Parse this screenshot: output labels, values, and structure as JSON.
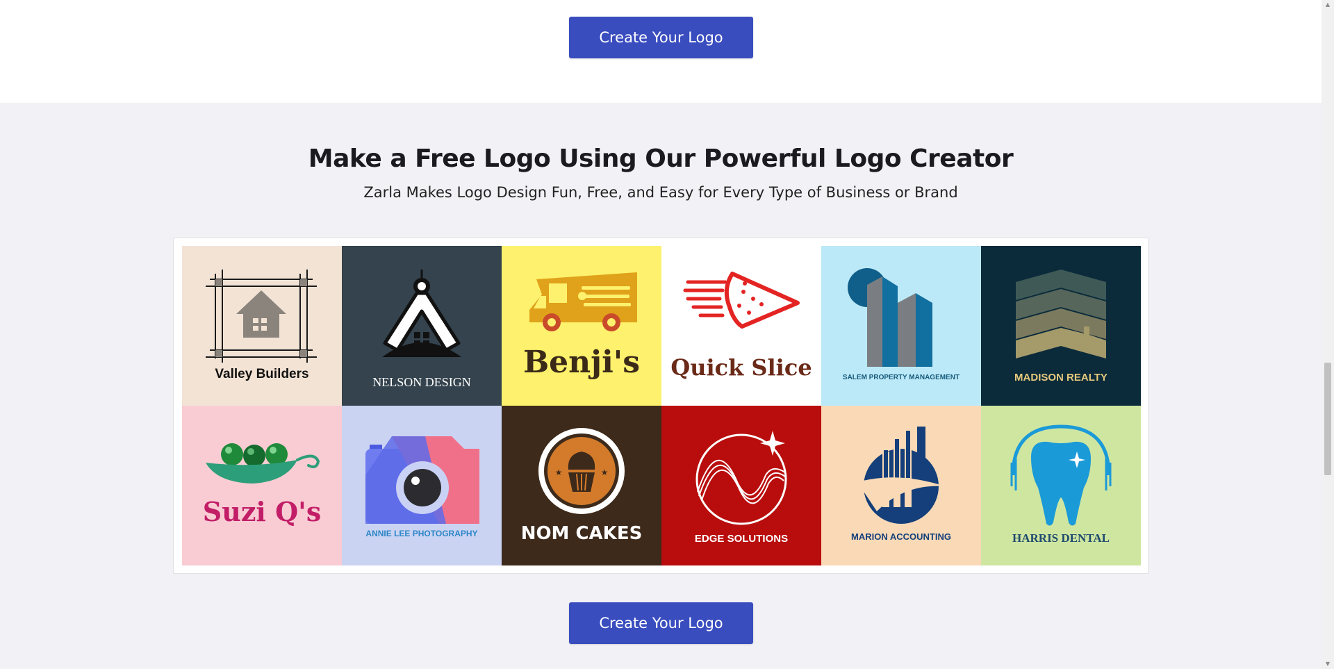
{
  "top_cta": {
    "label": "Create Your Logo"
  },
  "section": {
    "title": "Make a Free Logo Using Our Powerful Logo Creator",
    "subtitle": "Zarla Makes Logo Design Fun, Free, and Easy for Every Type of Business or Brand"
  },
  "logos": [
    {
      "name": "Valley Builders",
      "background": "#f3e3d4"
    },
    {
      "name": "NELSON DESIGN",
      "background": "#34434d"
    },
    {
      "name": "Benji's",
      "background": "#fdf16d"
    },
    {
      "name": "Quick Slice",
      "background": "#ffffff"
    },
    {
      "name": "SALEM PROPERTY MANAGEMENT",
      "background": "#bce9f8"
    },
    {
      "name": "MADISON REALTY",
      "background": "#0b2b3b"
    },
    {
      "name": "Suzi Q's",
      "background": "#f9ccd3"
    },
    {
      "name": "ANNIE LEE PHOTOGRAPHY",
      "background": "#cbd3f2"
    },
    {
      "name": "NOM CAKES",
      "background": "#3d2a1b"
    },
    {
      "name": "EDGE SOLUTIONS",
      "background": "#b90d0d"
    },
    {
      "name": "MARION ACCOUNTING",
      "background": "#f9d9b6"
    },
    {
      "name": "HARRIS DENTAL",
      "background": "#cfe6a1"
    }
  ],
  "bottom_cta": {
    "label": "Create Your Logo"
  },
  "colors": {
    "button": "#3a4dbf",
    "section_background": "#f2f1f5",
    "heading": "#1b1b1f"
  }
}
